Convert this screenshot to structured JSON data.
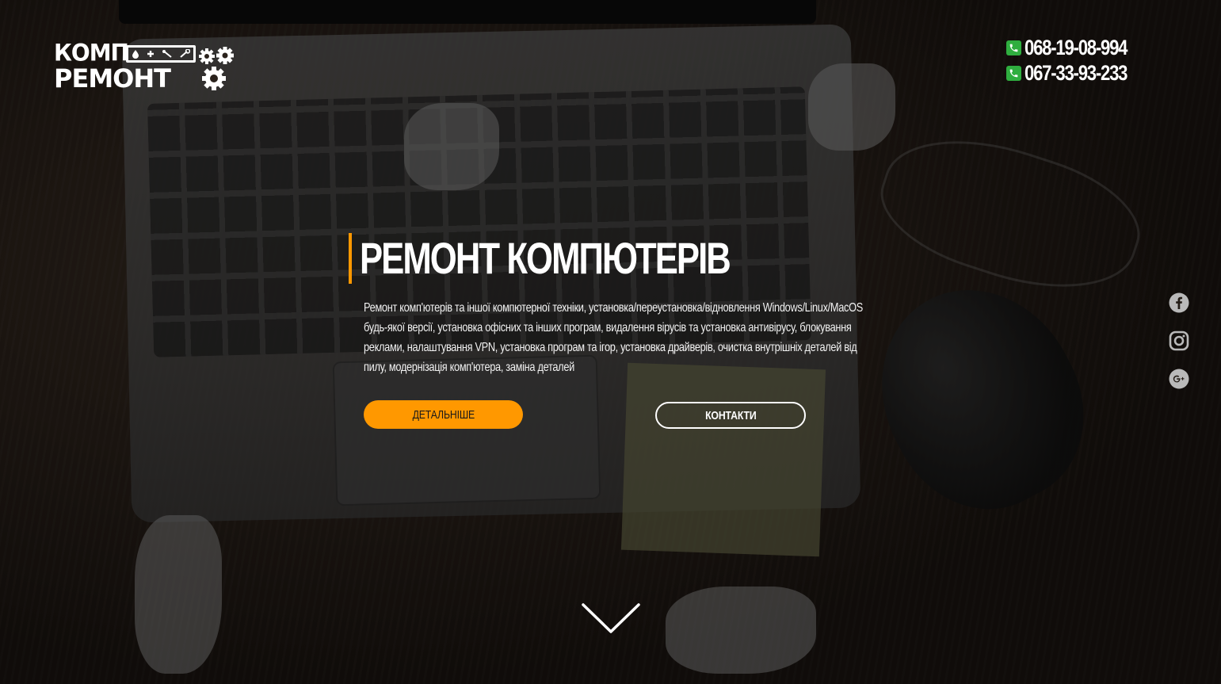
{
  "brand": {
    "line1": "КОМП",
    "line2": "РЕМОНТ",
    "toolbox_icons": [
      "drop-icon",
      "plus-icon",
      "screwdriver-icon",
      "wrench-icon"
    ],
    "gear_icons": [
      "gear-icon",
      "gear-icon",
      "gear-icon"
    ]
  },
  "contacts": {
    "phones": [
      "068-19-08-994",
      "067-33-93-233"
    ],
    "phone_icon_color": "#2fae3f"
  },
  "hero": {
    "title": "РЕМОНТ КОМПЮТЕРІВ",
    "accent_color": "#ff9800",
    "description": "Ремонт комп'ютерів та іншої компютерної техніки, установка/переустановка/відновлення Windows/Linux/MacOS будь-якої версії, установка офісних та інших програм, видалення вірусів та установка антивірусу, блокування реклами, налаштування VPN, установка програм та ігор, установка драйверів, очистка внутрішніх деталей від пилу, модернізація комп'ютера, заміна деталей",
    "buttons": {
      "more": "ДЕТАЛЬНІШЕ",
      "contacts": "КОНТАКТИ"
    }
  },
  "social": {
    "icons": [
      "facebook-icon",
      "instagram-icon",
      "google-plus-icon"
    ],
    "icon_color": "#b9b9b9"
  },
  "scroll": {
    "icon": "chevron-down-icon"
  }
}
